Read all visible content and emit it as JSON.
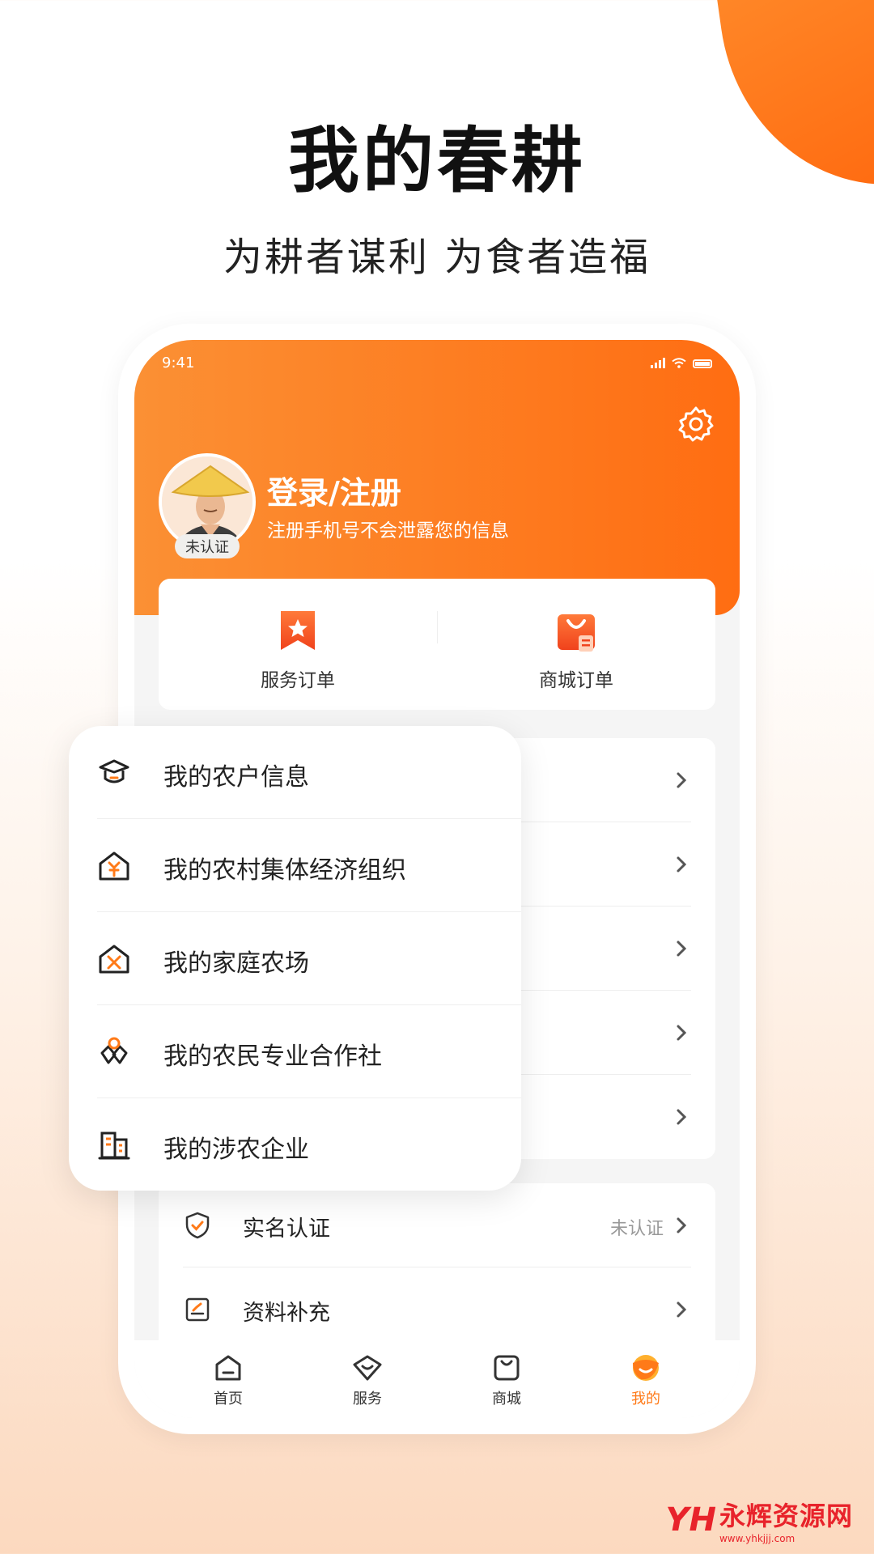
{
  "headline": "我的春耕",
  "subline": "为耕者谋利 为食者造福",
  "status_bar": {
    "time": "9:41"
  },
  "profile": {
    "title": "登录/注册",
    "subtitle": "注册手机号不会泄露您的信息",
    "badge": "未认证"
  },
  "orders": [
    {
      "label": "服务订单",
      "icon": "star-bookmark-icon"
    },
    {
      "label": "商城订单",
      "icon": "shopping-bag-icon"
    }
  ],
  "popup_menu": [
    {
      "label": "我的农户信息",
      "icon": "farmer-hat-icon"
    },
    {
      "label": "我的农村集体经济组织",
      "icon": "house-yuan-icon"
    },
    {
      "label": "我的家庭农场",
      "icon": "house-tools-icon"
    },
    {
      "label": "我的农民专业合作社",
      "icon": "cooperative-icon"
    },
    {
      "label": "我的涉农企业",
      "icon": "building-icon"
    }
  ],
  "settings": [
    {
      "label": "实名认证",
      "status": "未认证",
      "icon": "shield-check-icon"
    },
    {
      "label": "资料补充",
      "status": "",
      "icon": "edit-form-icon"
    }
  ],
  "tabbar": [
    {
      "label": "首页",
      "icon": "home-icon",
      "active": false
    },
    {
      "label": "服务",
      "icon": "service-icon",
      "active": false
    },
    {
      "label": "商城",
      "icon": "mall-icon",
      "active": false
    },
    {
      "label": "我的",
      "icon": "profile-icon",
      "active": true
    }
  ],
  "watermark": {
    "name": "永辉资源网",
    "url": "www.yhkjjj.com"
  },
  "colors": {
    "accent": "#ff7a18",
    "header_start": "#fb9034",
    "header_end": "#ff6d12"
  }
}
